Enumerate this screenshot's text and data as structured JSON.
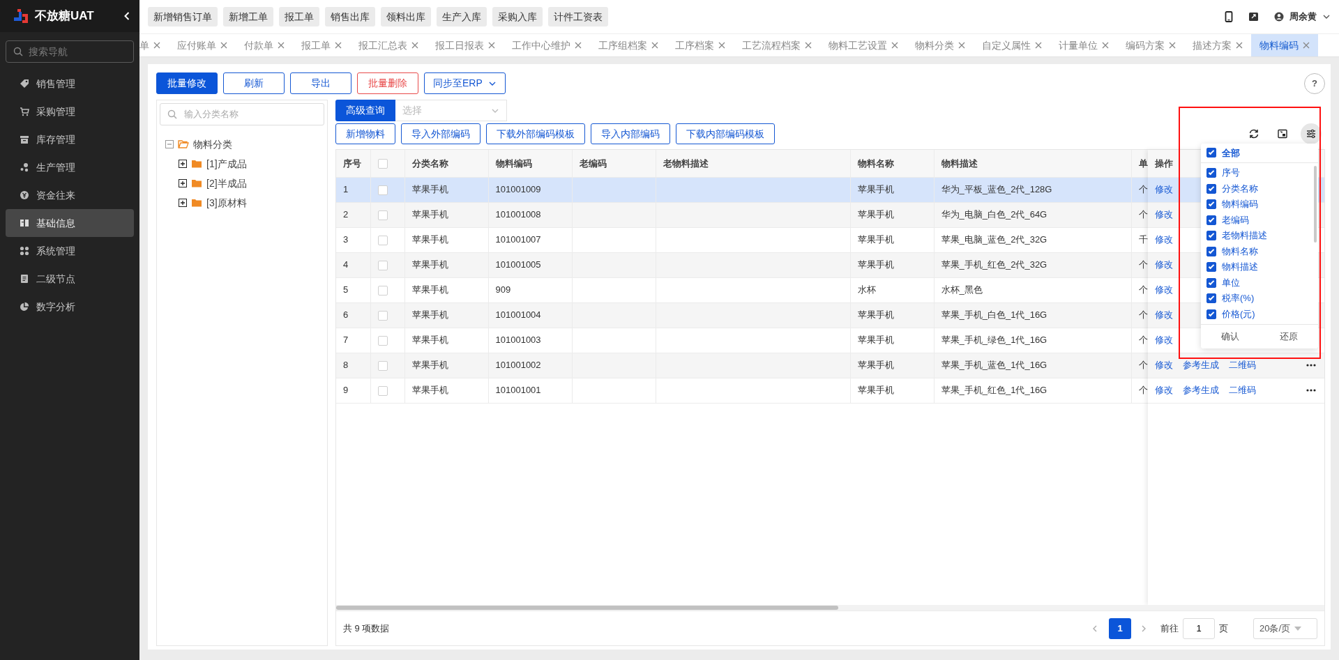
{
  "app": {
    "title": "不放糖UAT"
  },
  "sidebar": {
    "search_placeholder": "搜索导航",
    "items": [
      {
        "label": "销售管理",
        "selected": false
      },
      {
        "label": "采购管理",
        "selected": false
      },
      {
        "label": "库存管理",
        "selected": false
      },
      {
        "label": "生产管理",
        "selected": false
      },
      {
        "label": "资金往来",
        "selected": false
      },
      {
        "label": "基础信息",
        "selected": true
      },
      {
        "label": "系统管理",
        "selected": false
      },
      {
        "label": "二级节点",
        "selected": false
      },
      {
        "label": "数字分析",
        "selected": false
      }
    ]
  },
  "shortcuts": [
    "新增销售订单",
    "新增工单",
    "报工单",
    "销售出库",
    "领料出库",
    "生产入库",
    "采购入库",
    "计件工资表"
  ],
  "user": {
    "name": "周余黄"
  },
  "tabs": [
    {
      "label": "单",
      "selected": false
    },
    {
      "label": "应付账单",
      "selected": false
    },
    {
      "label": "付款单",
      "selected": false
    },
    {
      "label": "报工单",
      "selected": false
    },
    {
      "label": "报工汇总表",
      "selected": false
    },
    {
      "label": "报工日报表",
      "selected": false
    },
    {
      "label": "工作中心维护",
      "selected": false
    },
    {
      "label": "工序组档案",
      "selected": false
    },
    {
      "label": "工序档案",
      "selected": false
    },
    {
      "label": "工艺流程档案",
      "selected": false
    },
    {
      "label": "物料工艺设置",
      "selected": false
    },
    {
      "label": "物料分类",
      "selected": false
    },
    {
      "label": "自定义属性",
      "selected": false
    },
    {
      "label": "计量单位",
      "selected": false
    },
    {
      "label": "编码方案",
      "selected": false
    },
    {
      "label": "描述方案",
      "selected": false
    },
    {
      "label": "物料编码",
      "selected": true
    }
  ],
  "actions": [
    {
      "label": "批量修改",
      "kind": "primary"
    },
    {
      "label": "刷新",
      "kind": "outline"
    },
    {
      "label": "导出",
      "kind": "outline"
    },
    {
      "label": "批量删除",
      "kind": "danger"
    },
    {
      "label": "同步至ERP",
      "kind": "dropdown"
    }
  ],
  "help": "?",
  "tree": {
    "search_placeholder": "输入分类名称",
    "nodes": [
      {
        "label": "物料分类",
        "expanded": true,
        "children": [
          {
            "label": "[1]产成品",
            "expanded": false
          },
          {
            "label": "[2]半成品",
            "expanded": false
          },
          {
            "label": "[3]原材料",
            "expanded": false
          }
        ]
      }
    ]
  },
  "query": {
    "button": "高级查询",
    "select_placeholder": "选择"
  },
  "table_actions": [
    "新增物料",
    "导入外部编码",
    "下载外部编码模板",
    "导入内部编码",
    "下载内部编码模板"
  ],
  "table": {
    "columns": [
      "序号",
      "分类名称",
      "物料编码",
      "老编码",
      "老物料描述",
      "物料名称",
      "物料描述",
      "单"
    ],
    "action_column": "操作",
    "all_checked": false,
    "rows": [
      {
        "no": "1",
        "selected": true,
        "checked": false,
        "category": "苹果手机",
        "code": "101001009",
        "name": "苹果手机",
        "description": "华为_平板_蓝色_2代_128G",
        "unit": "个",
        "actions": [
          "修改"
        ],
        "more": false
      },
      {
        "no": "2",
        "selected": false,
        "checked": false,
        "category": "苹果手机",
        "code": "101001008",
        "name": "苹果手机",
        "description": "华为_电脑_白色_2代_64G",
        "unit": "个",
        "actions": [
          "修改"
        ],
        "more": false
      },
      {
        "no": "3",
        "selected": false,
        "checked": false,
        "category": "苹果手机",
        "code": "101001007",
        "name": "苹果手机",
        "description": "苹果_电脑_蓝色_2代_32G",
        "unit": "千",
        "actions": [
          "修改"
        ],
        "more": false
      },
      {
        "no": "4",
        "selected": false,
        "checked": false,
        "category": "苹果手机",
        "code": "101001005",
        "name": "苹果手机",
        "description": "苹果_手机_红色_2代_32G",
        "unit": "个",
        "actions": [
          "修改"
        ],
        "more": false
      },
      {
        "no": "5",
        "selected": false,
        "checked": false,
        "category": "苹果手机",
        "code": "909",
        "name": "水杯",
        "description": "水杯_黑色",
        "unit": "个",
        "actions": [
          "修改"
        ],
        "more": false
      },
      {
        "no": "6",
        "selected": false,
        "checked": false,
        "category": "苹果手机",
        "code": "101001004",
        "name": "苹果手机",
        "description": "苹果_手机_白色_1代_16G",
        "unit": "个",
        "actions": [
          "修改"
        ],
        "more": false
      },
      {
        "no": "7",
        "selected": false,
        "checked": false,
        "category": "苹果手机",
        "code": "101001003",
        "name": "苹果手机",
        "description": "苹果_手机_绿色_1代_16G",
        "unit": "个",
        "actions": [
          "修改"
        ],
        "more": false
      },
      {
        "no": "8",
        "selected": false,
        "checked": false,
        "category": "苹果手机",
        "code": "101001002",
        "name": "苹果手机",
        "description": "苹果_手机_蓝色_1代_16G",
        "unit": "个",
        "actions": [
          "修改",
          "参考生成",
          "二维码"
        ],
        "more": true
      },
      {
        "no": "9",
        "selected": false,
        "checked": false,
        "category": "苹果手机",
        "code": "101001001",
        "name": "苹果手机",
        "description": "苹果_手机_红色_1代_16G",
        "unit": "个",
        "actions": [
          "修改",
          "参考生成",
          "二维码"
        ],
        "more": true
      }
    ]
  },
  "column_settings": {
    "all_label": "全部",
    "all_checked": true,
    "items": [
      {
        "label": "序号",
        "checked": true
      },
      {
        "label": "分类名称",
        "checked": true
      },
      {
        "label": "物料编码",
        "checked": true
      },
      {
        "label": "老编码",
        "checked": true
      },
      {
        "label": "老物料描述",
        "checked": true
      },
      {
        "label": "物料名称",
        "checked": true
      },
      {
        "label": "物料描述",
        "checked": true
      },
      {
        "label": "单位",
        "checked": true
      },
      {
        "label": "税率(%)",
        "checked": true
      },
      {
        "label": "价格(元)",
        "checked": true
      }
    ],
    "confirm": "确认",
    "reset": "还原"
  },
  "pagination": {
    "total": "共 9 项数据",
    "pages": [
      {
        "label": "1",
        "selected": true
      }
    ],
    "goto_label": "前往",
    "goto_value": "1",
    "goto_suffix": "页",
    "page_size": "20条/页"
  }
}
